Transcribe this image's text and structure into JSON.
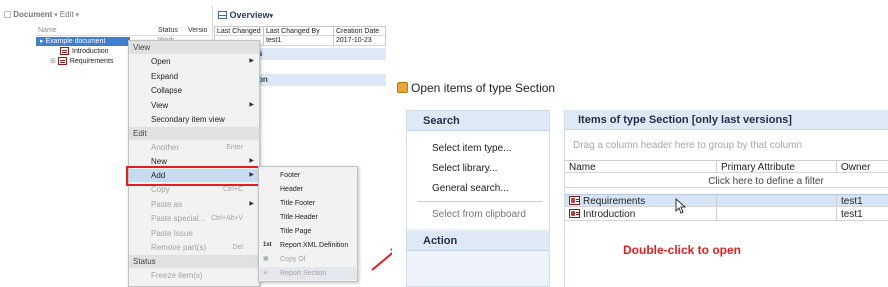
{
  "left_app": {
    "toolbar": {
      "document_label": "Document",
      "edit_label": "Edit"
    },
    "tree": {
      "columns": {
        "name": "Name",
        "status": "Status",
        "version": "Versio"
      },
      "status_cell": "Work",
      "items": [
        "Example document",
        "Introduction",
        "Requirements"
      ]
    },
    "overview": {
      "title": "Overview",
      "columns": [
        "Last Changed",
        "Last Changed By",
        "Creation Date"
      ],
      "row": [
        "",
        "test1",
        "2017-10-23"
      ],
      "partial_text_1": "s",
      "partial_text_2": "on"
    }
  },
  "context_menu": {
    "sections": {
      "view": "View",
      "edit": "Edit",
      "status": "Status"
    },
    "items": {
      "open": "Open",
      "expand": "Expand",
      "collapse": "Collapse",
      "view": "View",
      "secondary": "Secondary item view",
      "another": "Another",
      "another_shortcut": "Enter",
      "new": "New",
      "add": "Add",
      "copy": "Copy",
      "copy_shortcut": "Ctrl+C",
      "paste_as": "Paste as",
      "paste_special": "Paste special...",
      "paste_special_shortcut": "Ctrl+Alt+V",
      "paste_issue": "Paste Issue",
      "remove_parts": "Remove part(s)",
      "remove_shortcut": "Del",
      "freeze": "Freeze item(s)"
    }
  },
  "submenu": {
    "items": [
      "Footer",
      "Header",
      "Title Footer",
      "Title Header",
      "Title Page",
      "Report XML Definition",
      "Copy Of",
      "Report Section"
    ],
    "xml_icon_text": "1st"
  },
  "right_panel": {
    "window_title": "Open items of type Section",
    "search": {
      "header": "Search",
      "links": [
        "Select item type...",
        "Select library...",
        "General search...",
        "Select from clipboard"
      ]
    },
    "action_header": "Action",
    "grid": {
      "title": "Items of type Section [only last versions]",
      "group_hint": "Drag a column header here to group by that column",
      "columns": [
        "Name",
        "Primary Attribute",
        "Owner"
      ],
      "filter_text": "Click here to define a filter",
      "rows": [
        {
          "name": "Requirements",
          "primary": "",
          "owner": "test1"
        },
        {
          "name": "Introduction",
          "primary": "",
          "owner": "test1"
        }
      ]
    },
    "annotation": "Double-click to open"
  },
  "colors": {
    "highlight_red": "#e02020",
    "panel_blue": "#dfe9f6",
    "selection_blue": "#c9dbf0"
  }
}
